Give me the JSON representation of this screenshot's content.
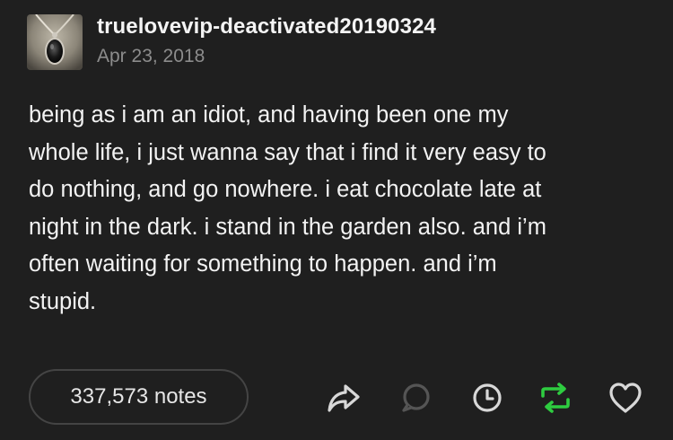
{
  "post": {
    "blog_name": "truelovevip-deactivated20190324",
    "date": "Apr 23, 2018",
    "body_lines": [
      "being as i am an idiot, and having been one my",
      "whole life, i just wanna say that i find it very easy to",
      "do nothing, and go nowhere. i eat chocolate late at",
      "night in the dark. i stand in the garden also. and i’m",
      "often waiting for something to happen. and i’m",
      "stupid."
    ]
  },
  "footer": {
    "notes_label": "337,573 notes",
    "actions": [
      {
        "icon": "share-icon"
      },
      {
        "icon": "reply-icon"
      },
      {
        "icon": "clock-icon"
      },
      {
        "icon": "reblog-icon"
      },
      {
        "icon": "heart-icon"
      }
    ]
  },
  "colors": {
    "background": "#1f1f1f",
    "text": "#f3f3f3",
    "muted": "#8c8c8c",
    "reblog_green": "#2ecc40",
    "icon_gray": "#d8d8d8",
    "reply_icon_gray": "#555555"
  }
}
